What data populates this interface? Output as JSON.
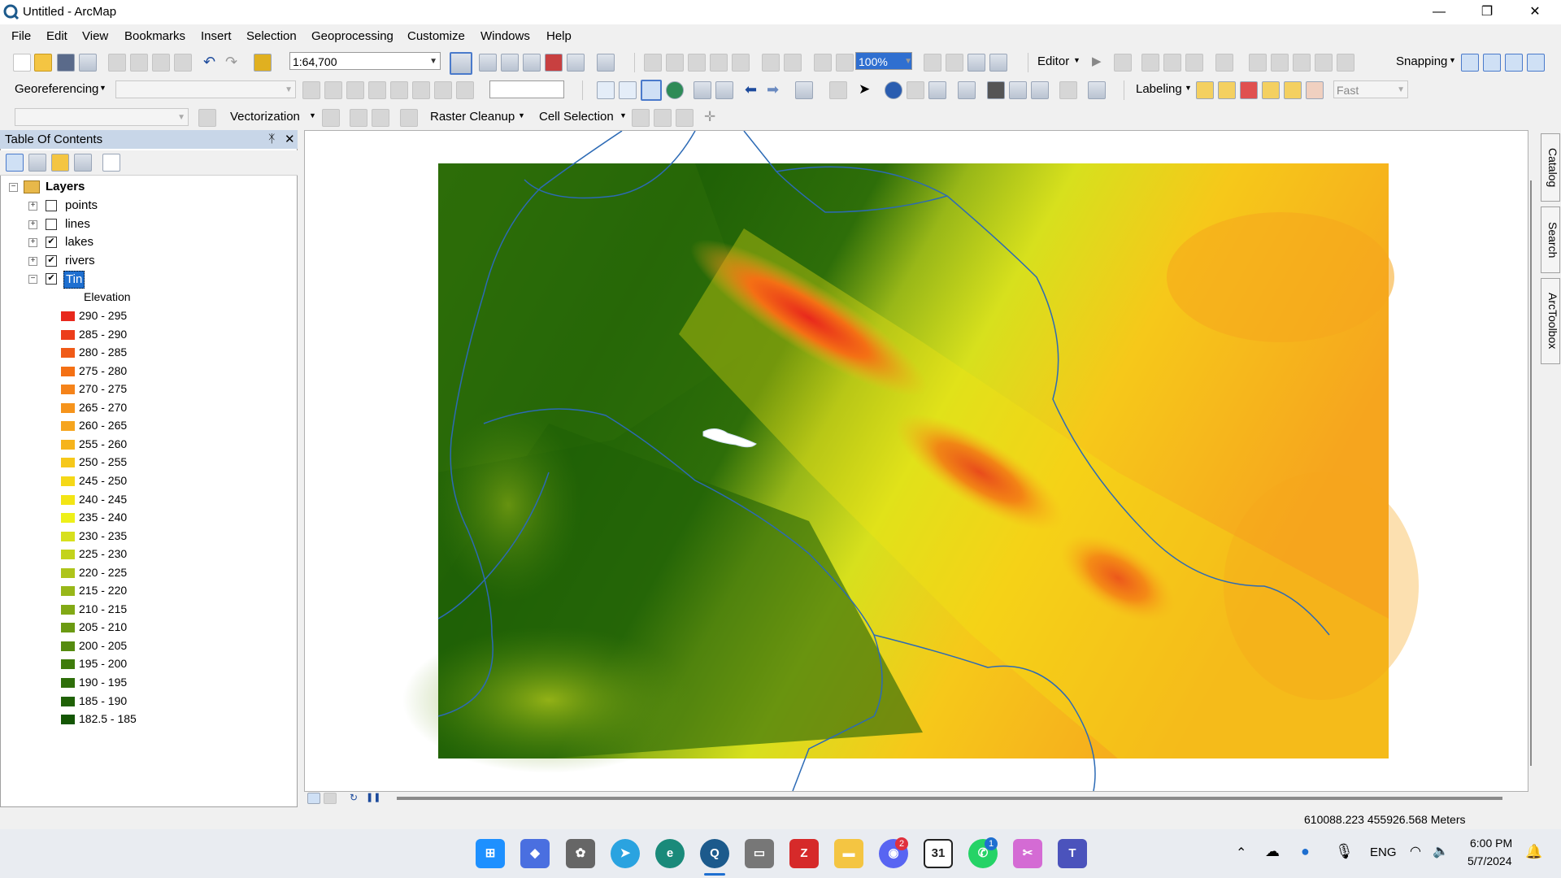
{
  "window": {
    "title": "Untitled - ArcMap",
    "minimize": "—",
    "restore": "❐",
    "close": "✕"
  },
  "menu": [
    "File",
    "Edit",
    "View",
    "Bookmarks",
    "Insert",
    "Selection",
    "Geoprocessing",
    "Customize",
    "Windows",
    "Help"
  ],
  "toolbar1": {
    "scale": "1:64,700",
    "editor": "Editor",
    "snapping": "Snapping",
    "zoom_value": "100%"
  },
  "toolbar2": {
    "georeferencing": "Georeferencing",
    "labeling": "Labeling",
    "fast": "Fast"
  },
  "toolbar3": {
    "vectorization": "Vectorization",
    "raster_cleanup": "Raster Cleanup",
    "cell_selection": "Cell Selection"
  },
  "toc": {
    "title": "Table Of Contents",
    "pin": "ᛡ",
    "close": "✕",
    "root": "Layers",
    "layers": [
      {
        "name": "points",
        "checked": false
      },
      {
        "name": "lines",
        "checked": false
      },
      {
        "name": "lakes",
        "checked": true
      },
      {
        "name": "rivers",
        "checked": true
      },
      {
        "name": "Tin",
        "checked": true
      }
    ],
    "legend_heading": "Elevation",
    "legend": [
      {
        "label": "290 - 295",
        "color": "#e8281c"
      },
      {
        "label": "285 - 290",
        "color": "#ec3d1a"
      },
      {
        "label": "280 - 285",
        "color": "#f05a17"
      },
      {
        "label": "275 - 280",
        "color": "#f47014"
      },
      {
        "label": "270 - 275",
        "color": "#f5831a"
      },
      {
        "label": "265 - 270",
        "color": "#f6941c"
      },
      {
        "label": "260 - 265",
        "color": "#f6a51e"
      },
      {
        "label": "255 - 260",
        "color": "#f6b41c"
      },
      {
        "label": "250 - 255",
        "color": "#f6c81a"
      },
      {
        "label": "245 - 250",
        "color": "#f5d817"
      },
      {
        "label": "240 - 245",
        "color": "#f3e515"
      },
      {
        "label": "235 - 240",
        "color": "#eef01a"
      },
      {
        "label": "230 - 235",
        "color": "#d7e01d"
      },
      {
        "label": "225 - 230",
        "color": "#c3d31c"
      },
      {
        "label": "220 - 225",
        "color": "#aec41a"
      },
      {
        "label": "215 - 220",
        "color": "#98b718"
      },
      {
        "label": "210 - 215",
        "color": "#82a915"
      },
      {
        "label": "205 - 210",
        "color": "#6b9a12"
      },
      {
        "label": "200 - 205",
        "color": "#558b0f"
      },
      {
        "label": "195 - 200",
        "color": "#3f7c0c"
      },
      {
        "label": "190 - 195",
        "color": "#2e6e09"
      },
      {
        "label": "185 - 190",
        "color": "#1f6106"
      },
      {
        "label": "182.5 - 185",
        "color": "#145604"
      }
    ]
  },
  "sidetabs": [
    "Catalog",
    "Search",
    "ArcToolbox"
  ],
  "status": {
    "coords": "610088.223  455926.568 Meters"
  },
  "taskbar": {
    "lang": "ENG",
    "time": "6:00 PM",
    "date": "5/7/2024",
    "discord_badge": "2",
    "whatsapp_badge": "1",
    "calendar_day": "31"
  }
}
